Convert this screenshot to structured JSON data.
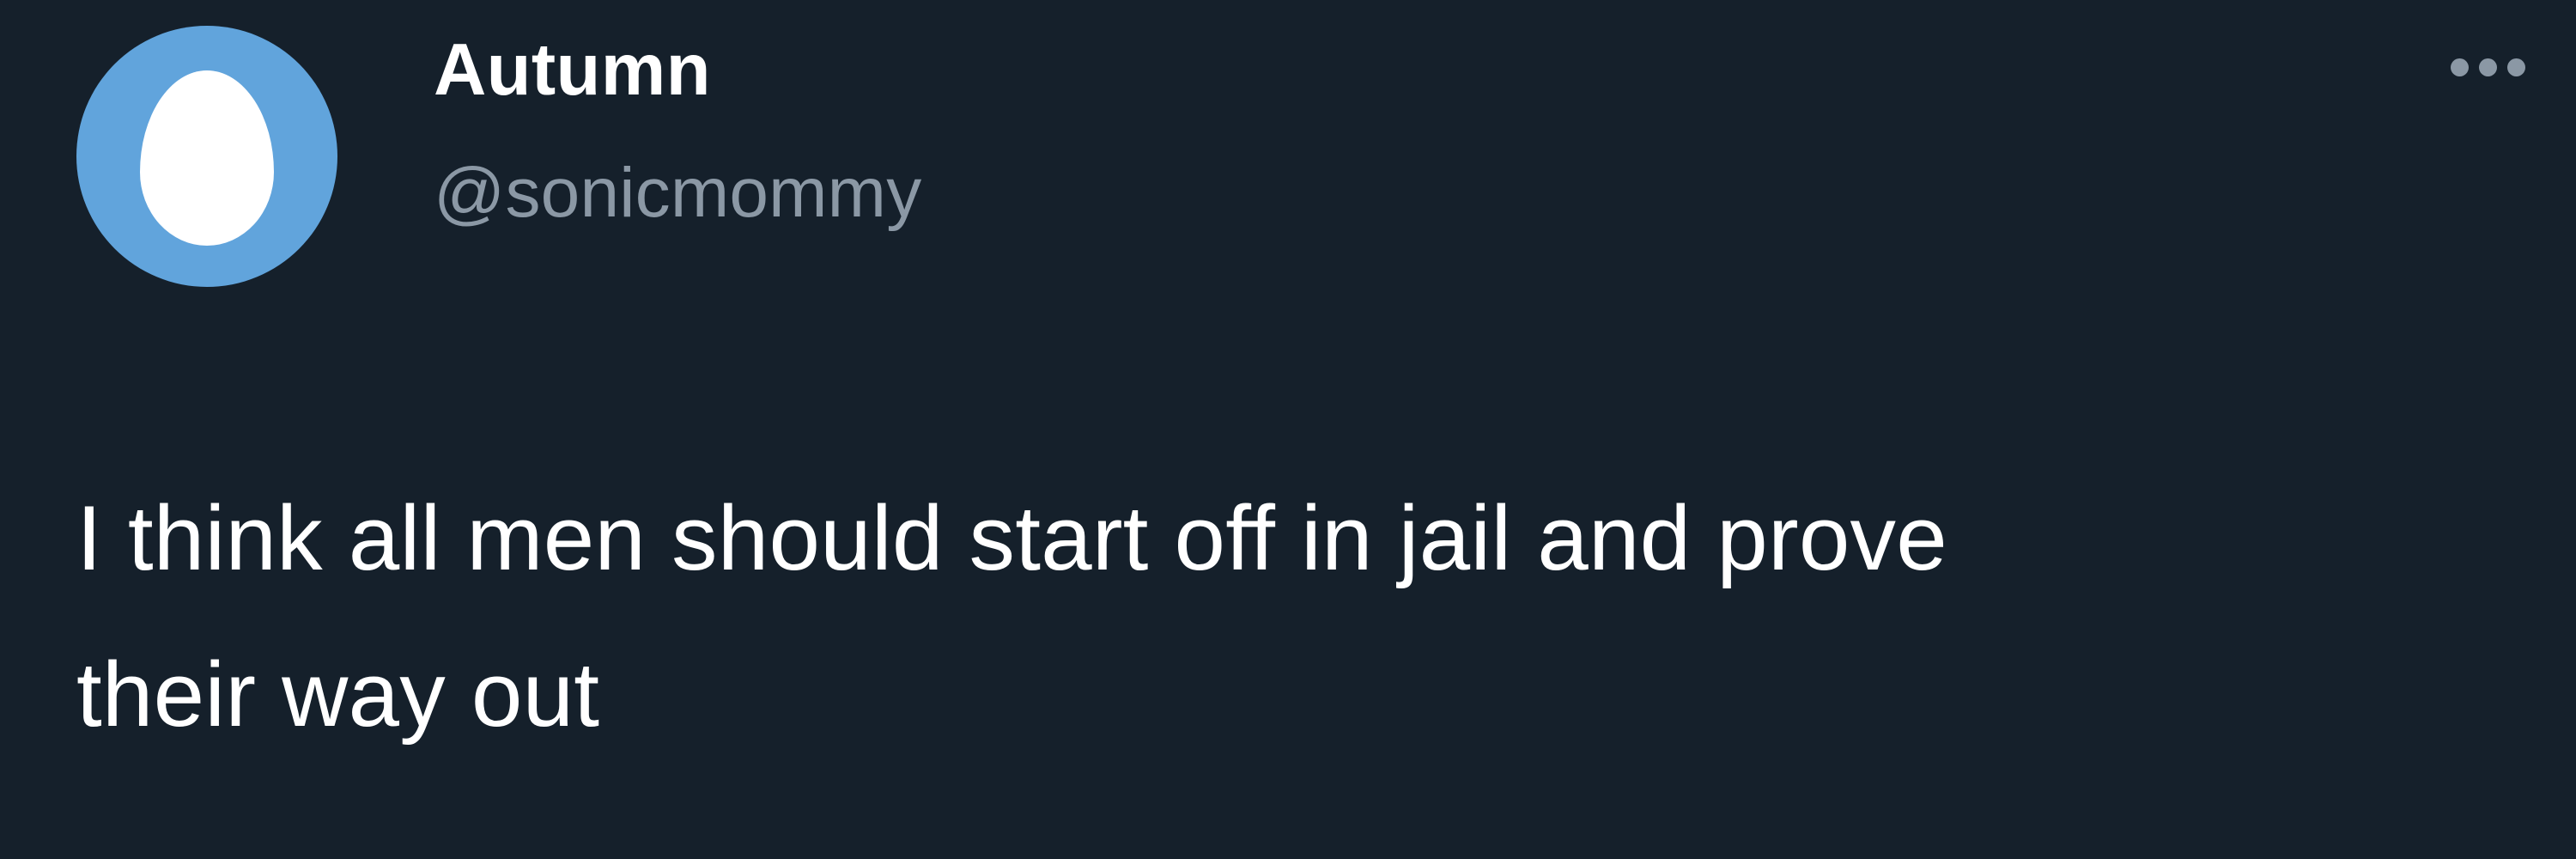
{
  "tweet": {
    "author": {
      "display_name": "Autumn",
      "handle": "@sonicmommy",
      "avatar": "default-egg-avatar"
    },
    "more_icon": "more-horizontal-icon",
    "text_lines": [
      "I think all men should start off in jail and prove",
      "their way out"
    ]
  },
  "colors": {
    "background": "#15202b",
    "text_primary": "#ffffff",
    "text_secondary": "#8b98a5",
    "avatar_blue": "#61a4dc"
  }
}
